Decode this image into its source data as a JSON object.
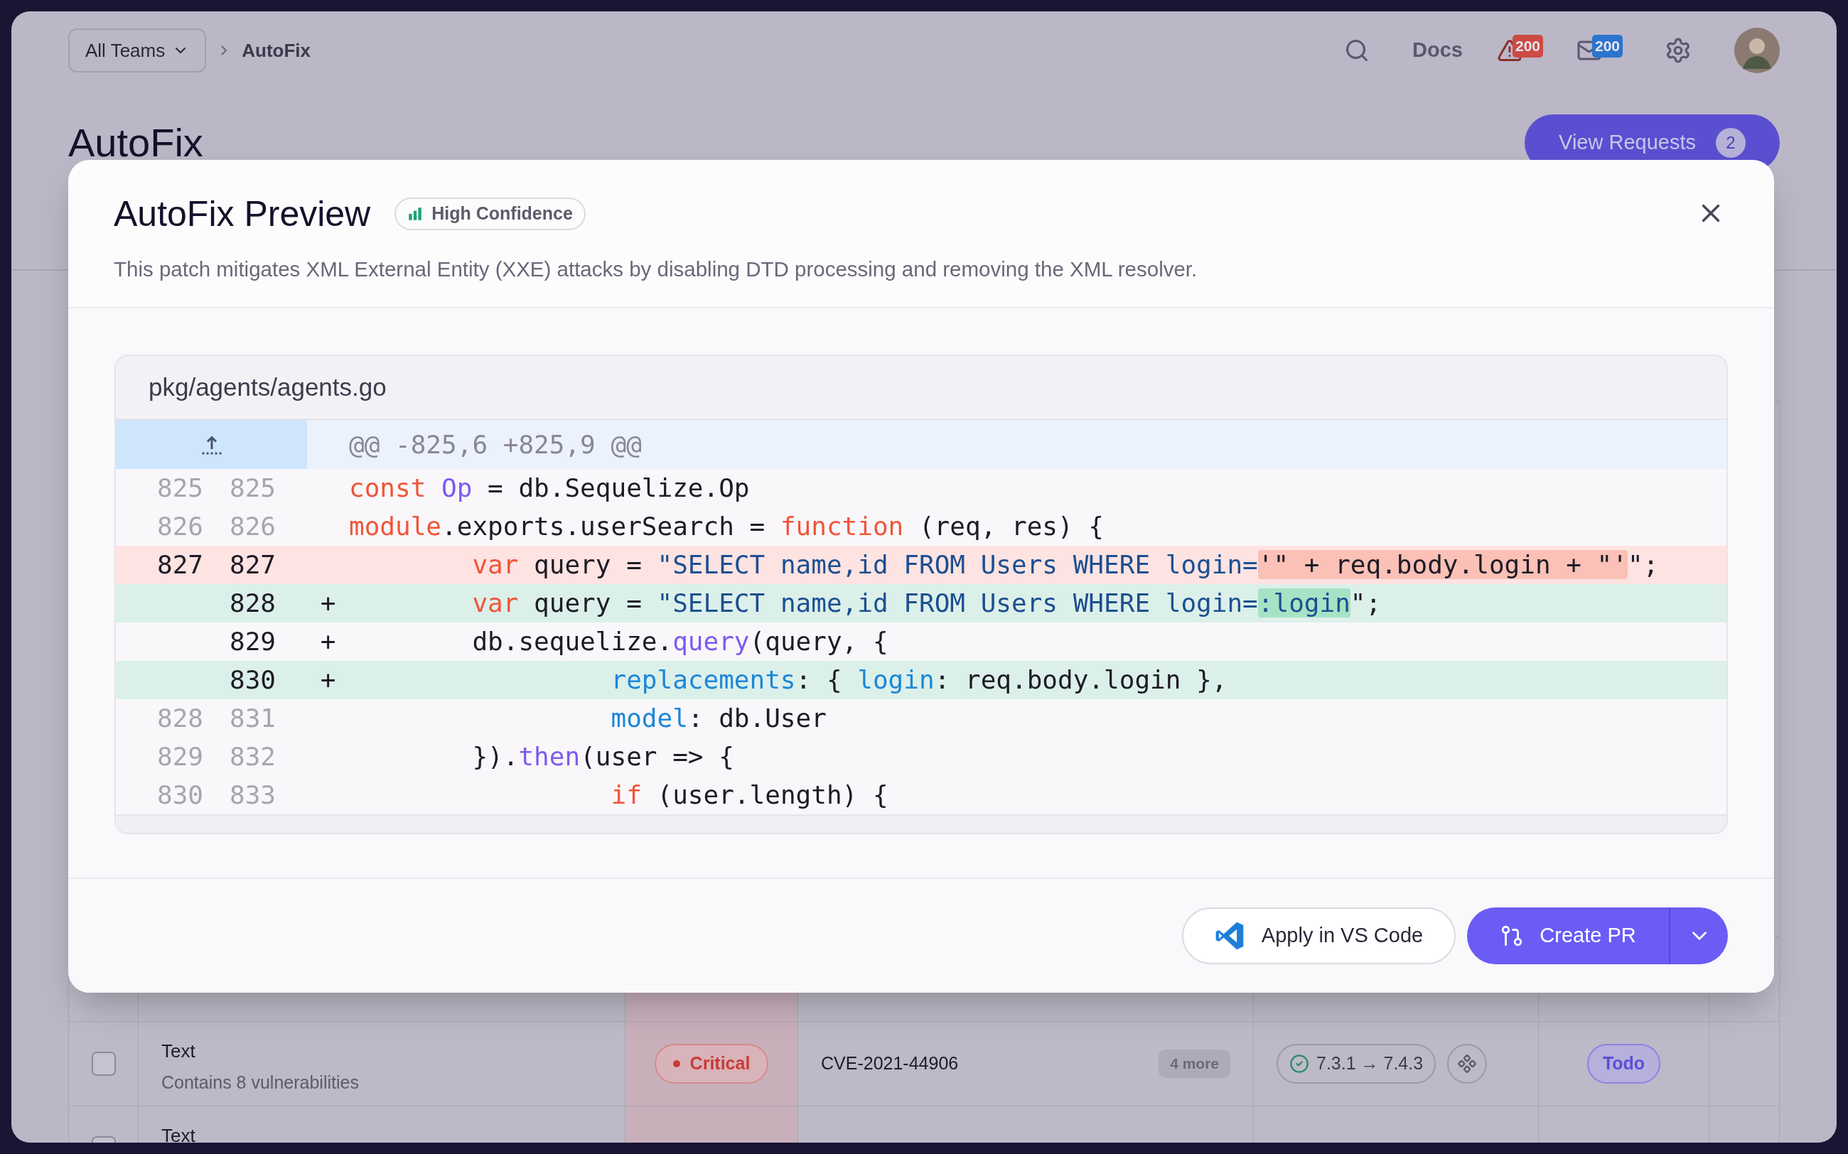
{
  "header": {
    "team_selector": "All Teams",
    "breadcrumb": "AutoFix",
    "docs": "Docs",
    "alerts_count": "200",
    "messages_count": "200"
  },
  "page": {
    "title": "AutoFix",
    "view_requests": {
      "label": "View Requests",
      "count": "2"
    }
  },
  "table": {
    "rows": [
      {
        "checked": false,
        "name": "Text",
        "detail": "Contains 8 vulnerabilities",
        "severity": "Critical",
        "cve": "CVE-2021-44906",
        "more": "4 more",
        "version": "7.3.1 → 7.4.3",
        "status": "Todo"
      },
      {
        "checked": false,
        "name": "Text"
      }
    ]
  },
  "modal": {
    "title": "AutoFix Preview",
    "confidence": "High Confidence",
    "description": "This patch mitigates XML External Entity (XXE) attacks by disabling DTD processing and removing the XML resolver.",
    "file": {
      "path": "pkg/agents/agents.go",
      "hunk": "@@ -825,6 +825,9 @@",
      "lines": [
        {
          "old": "825",
          "new": "825",
          "kind": "context",
          "highlight": false,
          "tokens": [
            {
              "text": "const ",
              "kind": "keyword"
            },
            {
              "text": "Op",
              "kind": "identifier"
            },
            {
              "text": " = db.Sequelize.Op",
              "kind": "plain"
            }
          ]
        },
        {
          "old": "826",
          "new": "826",
          "kind": "context",
          "highlight": false,
          "tokens": [
            {
              "text": "module",
              "kind": "keyword"
            },
            {
              "text": ".exports.userSearch = ",
              "kind": "plain"
            },
            {
              "text": "function",
              "kind": "keyword"
            },
            {
              "text": " (req, res) {",
              "kind": "plain"
            }
          ]
        },
        {
          "old": "827",
          "new": "827",
          "kind": "removed",
          "highlight": true,
          "tokens": [
            {
              "text": "        var",
              "kind": "keyword"
            },
            {
              "text": " query = ",
              "kind": "plain"
            },
            {
              "text": "\"SELECT name,id FROM Users WHERE login=",
              "kind": "string"
            },
            {
              "text": "'\" + req.body.login + \"'",
              "kind": "deleted"
            },
            {
              "text": "\";",
              "kind": "plain"
            }
          ]
        },
        {
          "new": "828",
          "sign": "+",
          "kind": "added",
          "highlight": true,
          "tokens": [
            {
              "text": "        var",
              "kind": "keyword"
            },
            {
              "text": " query = ",
              "kind": "plain"
            },
            {
              "text": "\"SELECT name,id FROM Users WHERE login=",
              "kind": "string"
            },
            {
              "text": ":login",
              "kind": "inserted"
            },
            {
              "text": "\";",
              "kind": "plain"
            }
          ]
        },
        {
          "new": "829",
          "sign": "+",
          "kind": "added",
          "highlight": false,
          "tokens": [
            {
              "text": "        db.sequelize.",
              "kind": "plain"
            },
            {
              "text": "query",
              "kind": "identifier"
            },
            {
              "text": "(query, {",
              "kind": "plain"
            }
          ]
        },
        {
          "new": "830",
          "sign": "+",
          "kind": "added",
          "highlight": true,
          "tokens": [
            {
              "text": "                 replacements",
              "kind": "property"
            },
            {
              "text": ": { ",
              "kind": "plain"
            },
            {
              "text": "login",
              "kind": "property"
            },
            {
              "text": ": req.body.login },",
              "kind": "plain"
            }
          ]
        },
        {
          "old": "828",
          "new": "831",
          "kind": "context",
          "highlight": false,
          "tokens": [
            {
              "text": "                 model",
              "kind": "property"
            },
            {
              "text": ": db.User",
              "kind": "plain"
            }
          ]
        },
        {
          "old": "829",
          "new": "832",
          "kind": "context",
          "highlight": false,
          "tokens": [
            {
              "text": "        }).",
              "kind": "plain"
            },
            {
              "text": "then",
              "kind": "identifier"
            },
            {
              "text": "(user => {",
              "kind": "plain"
            }
          ]
        },
        {
          "old": "830",
          "new": "833",
          "kind": "context",
          "highlight": false,
          "tokens": [
            {
              "text": "                 if",
              "kind": "keyword"
            },
            {
              "text": " (user.length) {",
              "kind": "plain"
            }
          ]
        }
      ]
    },
    "actions": {
      "apply": "Apply in VS Code",
      "create_pr": "Create PR"
    }
  }
}
